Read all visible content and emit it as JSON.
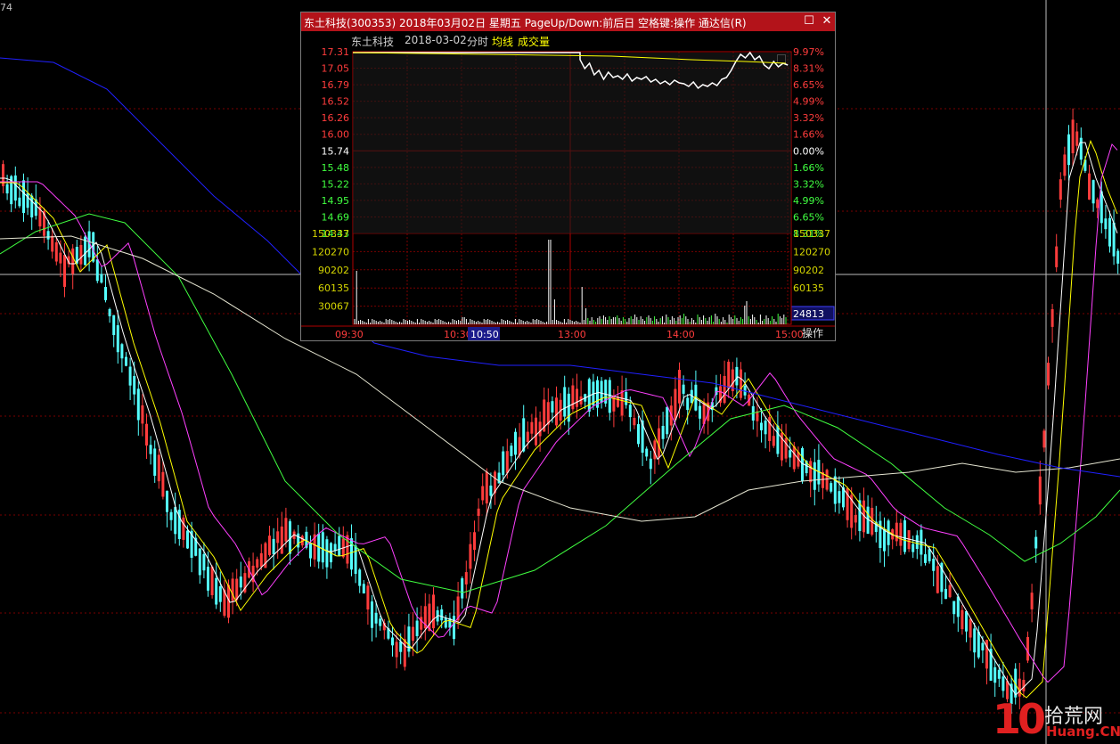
{
  "corner_label": "74",
  "popup": {
    "title": "东土科技(300353)  2018年03月02日  星期五  PageUp/Down:前后日  空格键:操作  通达信(R)",
    "stock_name": "东土科技",
    "date": "2018-03-02",
    "view": "分时",
    "avg_line_label": "均线",
    "volume_label": "成交量",
    "price_labels": [
      "17.31",
      "17.05",
      "16.79",
      "16.52",
      "16.26",
      "16.00",
      "15.74",
      "15.48",
      "15.22",
      "14.95",
      "14.69",
      "14.43"
    ],
    "pct_labels": [
      "9.97%",
      "8.31%",
      "6.65%",
      "4.99%",
      "3.32%",
      "1.66%",
      "0.00%",
      "1.66%",
      "3.32%",
      "4.99%",
      "6.65%",
      "8.31%"
    ],
    "volume_labels": [
      "150337",
      "120270",
      "90202",
      "60135",
      "30067"
    ],
    "volume_labels_right": [
      "150337",
      "120270",
      "90202",
      "60135"
    ],
    "current_volume": "24813",
    "time_labels": [
      "09:30",
      "10:30",
      "10:50",
      "13:00",
      "14:00",
      "15:00"
    ],
    "highlight_time": "10:50",
    "operation_button": "操作",
    "close_glyph": "✕",
    "max_glyph": "☐"
  },
  "colors": {
    "up": "#ff3c3c",
    "down": "#54ffff",
    "ma5": "#ffffff",
    "ma10": "#ffff00",
    "ma20": "#ff40ff",
    "ma60": "#40ff40",
    "ma120": "#e6e6d2",
    "ma250": "#2020ff",
    "grid": "#7a0000",
    "title_bar": "#b3131a"
  },
  "watermark": {
    "logo_digits": "10",
    "cn": "拾荒网",
    "en": "Huang.CN"
  }
}
